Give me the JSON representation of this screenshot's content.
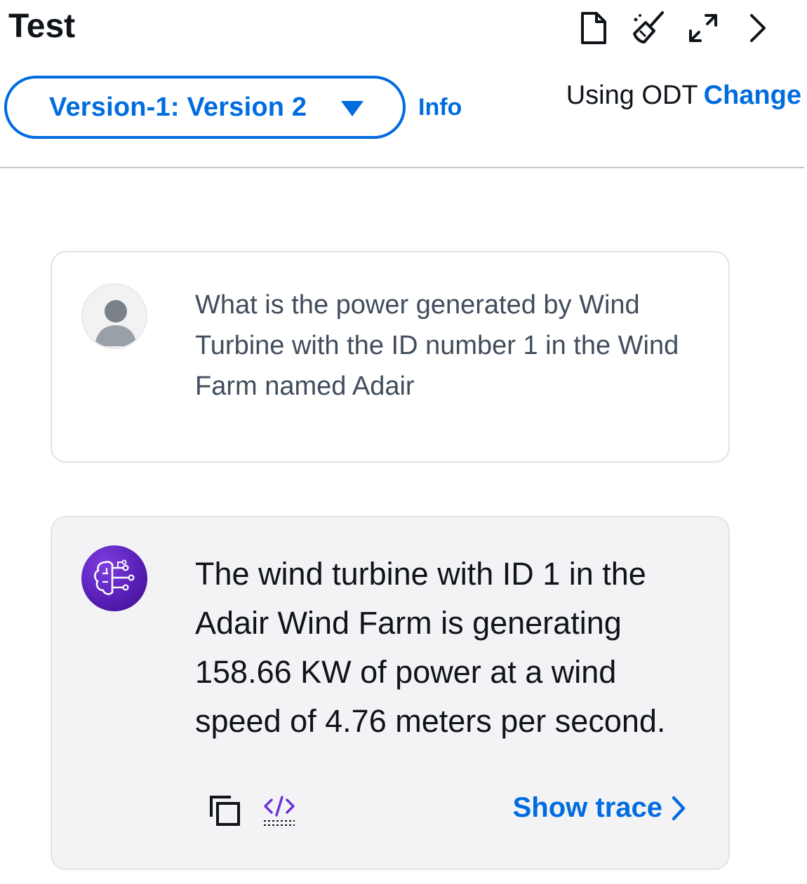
{
  "panel": {
    "title": "Test"
  },
  "header_icons": [
    {
      "name": "document-icon"
    },
    {
      "name": "broom-icon"
    },
    {
      "name": "expand-icon"
    },
    {
      "name": "chevron-right-icon"
    }
  ],
  "version_select": {
    "value": "Version-1: Version 2"
  },
  "info_link": "Info",
  "model_row": {
    "using": "Using ODT",
    "change": "Change"
  },
  "messages": {
    "user": {
      "text": "What is the power generated by Wind Turbine with the ID number 1 in the Wind Farm named Adair"
    },
    "agent": {
      "text": "The wind turbine with ID 1 in the Adair Wind Farm is generating 158.66 KW of power at a wind speed of 4.76 meters per second.",
      "show_trace": "Show trace"
    }
  },
  "colors": {
    "link": "#006ce0",
    "agent_bg": "#f3f3f5",
    "agent_avatar": "#5a1fb8"
  }
}
